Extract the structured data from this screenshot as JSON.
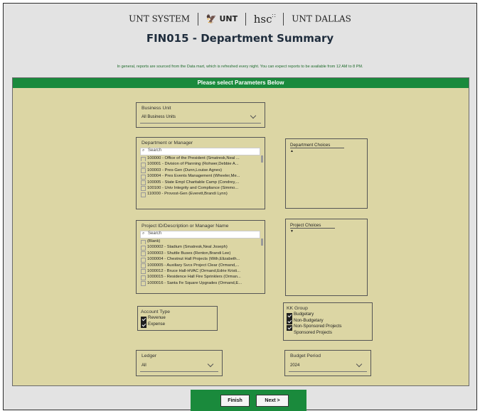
{
  "header": {
    "logos": {
      "unt_system": "UNT SYSTEM",
      "unt": "UNT",
      "hsc": "hsc",
      "unt_dallas": "UNT DALLAS"
    },
    "title": "FIN015 - Department Summary",
    "notice": "In general, reports are sourced from the Data mart, which is refreshed every night. You can expect reports to be available from 12 AM to 8 PM."
  },
  "panel": {
    "heading": "Please select Parameters Below",
    "business_unit": {
      "label": "Business Unit",
      "value": "All Business Units"
    },
    "department": {
      "label": "Department or Manager",
      "search_placeholder": "Search",
      "items": [
        "100000 - Office of the President (Smatresk,Neal ...",
        "100001 - Division of Planning (Rohwer,Debbie A...",
        "100003 - Pres-Gen (Dunn,Louise Agnes)",
        "100004 - Pres Events Management (Wheeler,Me...",
        "100005 - State Empl Charitable Camp (Condrey,...",
        "100100 - Univ Integrity and Compliance (Simmo...",
        "110000 - Provost-Gen (Everett,Brandi Lynn)"
      ]
    },
    "department_choices": {
      "label": "Department Choices"
    },
    "project": {
      "label": "Project ID/Description or Manager Name",
      "search_placeholder": "Search",
      "items": [
        "(Blank)",
        "1000002 - Stadium (Smatresk,Neal Joseph)",
        "1000003 - Shuttle Buses (Renton,Brandi Lee)",
        "1000004 - Chestnut Hall Projects (With,Elizabeth...",
        "1000005 - Auxiliary Svcs Project Clear (Ormand,...",
        "1000012 - Bruce Hall-HVAC (Ormand,Edrie Kristi...",
        "1000015 - Residence Hall Fire Sprinklers (Orman...",
        "1000016 - Santa Fe Square Upgrades (Ormand,E..."
      ]
    },
    "project_choices": {
      "label": "Project Choices"
    },
    "account_type": {
      "label": "Account Type",
      "options": [
        {
          "label": "Revenue",
          "checked": true
        },
        {
          "label": "Expense",
          "checked": true
        }
      ]
    },
    "kk_group": {
      "label": "KK Group",
      "options": [
        {
          "label": "Budgetary",
          "checked": true
        },
        {
          "label": "Non-Budgetary",
          "checked": true
        },
        {
          "label": "Non-Sponsored Projects",
          "checked": true
        },
        {
          "label": "Sponsored Projects",
          "checked": false
        }
      ]
    },
    "ledger": {
      "label": "Ledger",
      "value": "All"
    },
    "budget_period": {
      "label": "Budget Period",
      "value": "2024"
    }
  },
  "footer": {
    "finish_label": "Finish",
    "next_label": "Next >"
  },
  "colors": {
    "accent_green": "#1a8a3c",
    "panel_bg": "#dcd6a4"
  }
}
